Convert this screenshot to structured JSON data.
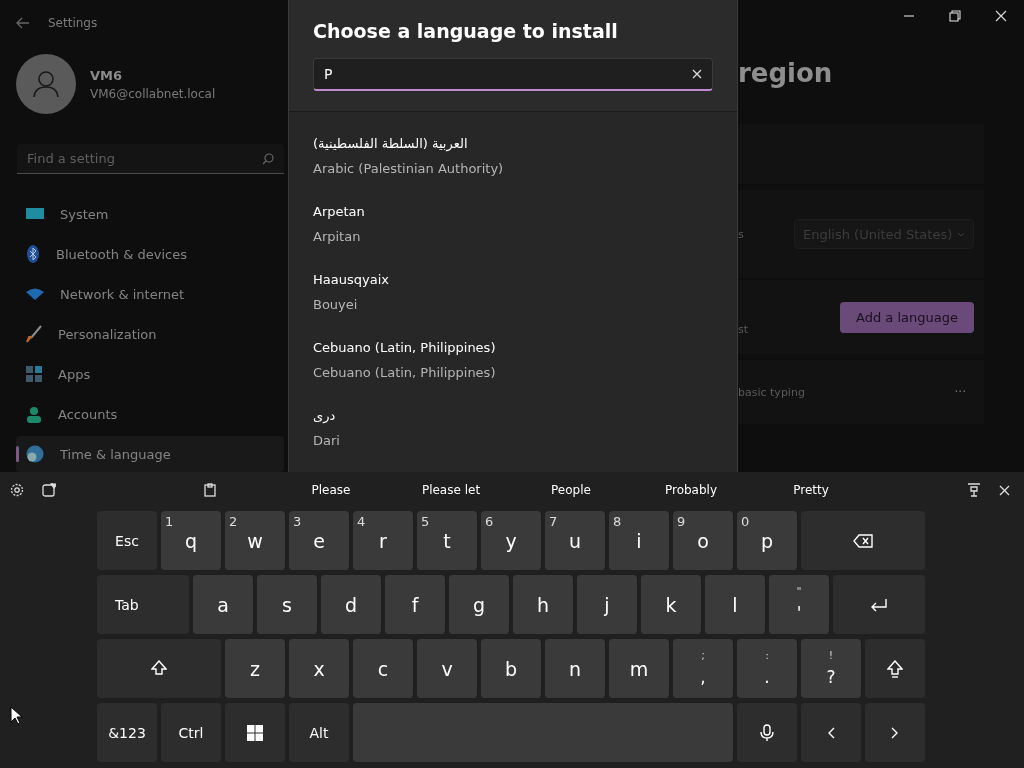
{
  "window": {
    "title": "Settings"
  },
  "user": {
    "name": "VM6",
    "email": "VM6@collabnet.local"
  },
  "sidebar": {
    "search": {
      "placeholder": "Find a setting"
    },
    "items": [
      {
        "label": "System",
        "selected": false
      },
      {
        "label": "Bluetooth & devices",
        "selected": false
      },
      {
        "label": "Network & internet",
        "selected": false
      },
      {
        "label": "Personalization",
        "selected": false
      },
      {
        "label": "Apps",
        "selected": false
      },
      {
        "label": "Accounts",
        "selected": false
      },
      {
        "label": "Time & language",
        "selected": true
      }
    ]
  },
  "dialog": {
    "title": "Choose a language to install",
    "search": {
      "value": "P"
    },
    "languages": [
      {
        "native": "العربية (السلطة الفلسطينية)",
        "english": "Arabic (Palestinian Authority)"
      },
      {
        "native": "Arpetan",
        "english": "Arpitan"
      },
      {
        "native": "Haausqyaix",
        "english": "Bouyei"
      },
      {
        "native": "Cebuano (Latin, Philippines)",
        "english": "Cebuano (Latin, Philippines)"
      },
      {
        "native": "دری",
        "english": "Dari"
      }
    ]
  },
  "page": {
    "heading": "region",
    "display_language_label": "s",
    "display_language": "English (United States)",
    "preferred_label": "st",
    "add_button": "Add a language",
    "language_detail": "basic typing",
    "more": "···"
  },
  "keyboard": {
    "suggestions": [
      "Please",
      "Please let",
      "People",
      "Probably",
      "Pretty"
    ],
    "rows": [
      {
        "keys": [
          {
            "kind": "text",
            "label": "Esc"
          },
          {
            "kind": "letter",
            "label": "q",
            "secondary": "1"
          },
          {
            "kind": "letter",
            "label": "w",
            "secondary": "2"
          },
          {
            "kind": "letter",
            "label": "e",
            "secondary": "3"
          },
          {
            "kind": "letter",
            "label": "r",
            "secondary": "4"
          },
          {
            "kind": "letter",
            "label": "t",
            "secondary": "5"
          },
          {
            "kind": "letter",
            "label": "y",
            "secondary": "6"
          },
          {
            "kind": "letter",
            "label": "u",
            "secondary": "7"
          },
          {
            "kind": "letter",
            "label": "i",
            "secondary": "8"
          },
          {
            "kind": "letter",
            "label": "o",
            "secondary": "9"
          },
          {
            "kind": "letter",
            "label": "p",
            "secondary": "0"
          },
          {
            "kind": "backspace"
          }
        ]
      },
      {
        "keys": [
          {
            "kind": "tab",
            "label": "Tab"
          },
          {
            "kind": "letter",
            "label": "a"
          },
          {
            "kind": "letter",
            "label": "s"
          },
          {
            "kind": "letter",
            "label": "d"
          },
          {
            "kind": "letter",
            "label": "f"
          },
          {
            "kind": "letter",
            "label": "g"
          },
          {
            "kind": "letter",
            "label": "h"
          },
          {
            "kind": "letter",
            "label": "j"
          },
          {
            "kind": "letter",
            "label": "k"
          },
          {
            "kind": "letter",
            "label": "l"
          },
          {
            "kind": "symbol",
            "label": "'",
            "secondary": "\""
          },
          {
            "kind": "enter"
          }
        ]
      },
      {
        "keys": [
          {
            "kind": "shift-wide"
          },
          {
            "kind": "letter",
            "label": "z"
          },
          {
            "kind": "letter",
            "label": "x"
          },
          {
            "kind": "letter",
            "label": "c"
          },
          {
            "kind": "letter",
            "label": "v"
          },
          {
            "kind": "letter",
            "label": "b"
          },
          {
            "kind": "letter",
            "label": "n"
          },
          {
            "kind": "letter",
            "label": "m"
          },
          {
            "kind": "symbol",
            "label": ",",
            "secondary": ";"
          },
          {
            "kind": "symbol",
            "label": ".",
            "secondary": ":"
          },
          {
            "kind": "symbol",
            "label": "?",
            "secondary": "!"
          },
          {
            "kind": "shift"
          }
        ]
      },
      {
        "keys": [
          {
            "kind": "text",
            "label": "&123"
          },
          {
            "kind": "text",
            "label": "Ctrl"
          },
          {
            "kind": "windows"
          },
          {
            "kind": "text",
            "label": "Alt"
          },
          {
            "kind": "space"
          },
          {
            "kind": "mic"
          },
          {
            "kind": "left"
          },
          {
            "kind": "right"
          }
        ]
      }
    ]
  }
}
